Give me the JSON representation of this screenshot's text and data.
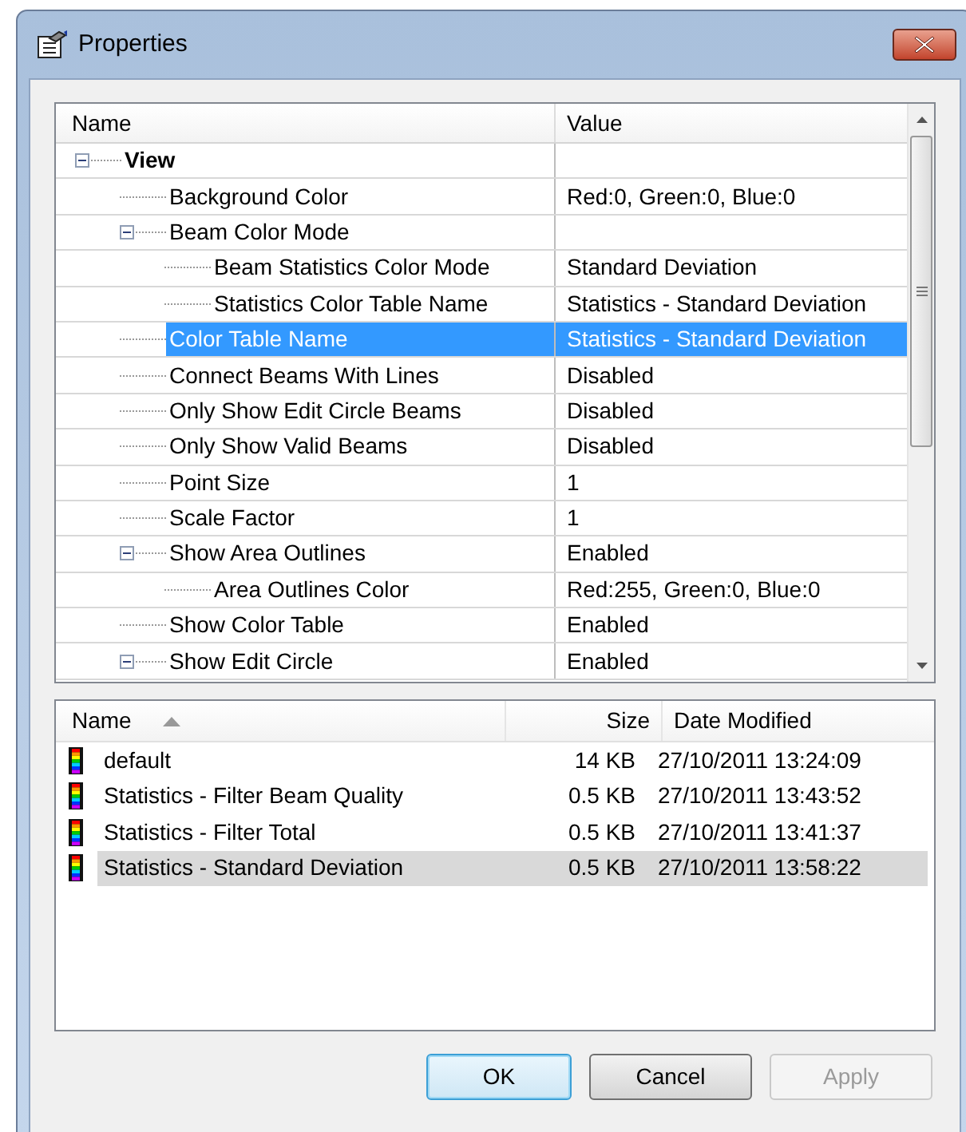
{
  "window": {
    "title": "Properties"
  },
  "property_grid": {
    "columns": [
      "Name",
      "Value"
    ],
    "rows": [
      {
        "name": "View",
        "expanded": true,
        "selected": false,
        "children": [
          {
            "name": "Background Color",
            "value": "Red:0, Green:0, Blue:0",
            "selected": false
          },
          {
            "name": "Beam Color Mode",
            "expanded": true,
            "selected": false,
            "children": [
              {
                "name": "Beam Statistics Color Mode",
                "value": "Standard Deviation",
                "selected": false
              },
              {
                "name": "Statistics Color Table Name",
                "value": "Statistics - Standard Deviation",
                "selected": false
              }
            ]
          },
          {
            "name": "Color Table Name",
            "value": "Statistics - Standard Deviation",
            "selected": true
          },
          {
            "name": "Connect Beams With Lines",
            "value": "Disabled",
            "selected": false
          },
          {
            "name": "Only Show Edit Circle Beams",
            "value": "Disabled",
            "selected": false
          },
          {
            "name": "Only Show Valid Beams",
            "value": "Disabled",
            "selected": false
          },
          {
            "name": "Point Size",
            "value": "1",
            "selected": false
          },
          {
            "name": "Scale Factor",
            "value": "1",
            "selected": false
          },
          {
            "name": "Show Area Outlines",
            "value": "Enabled",
            "expanded": true,
            "selected": false,
            "children": [
              {
                "name": "Area Outlines Color",
                "value": "Red:255, Green:0, Blue:0",
                "selected": false
              }
            ]
          },
          {
            "name": "Show Color Table",
            "value": "Enabled",
            "selected": false
          },
          {
            "name": "Show Edit Circle",
            "value": "Enabled",
            "expanded": true,
            "selected": false
          }
        ]
      }
    ]
  },
  "file_list": {
    "columns": [
      "Name",
      "Size",
      "Date Modified"
    ],
    "rows": [
      {
        "name": "default",
        "size": "14 KB",
        "date": "27/10/2011 13:24:09",
        "selected": false
      },
      {
        "name": "Statistics - Filter Beam Quality",
        "size": "0.5 KB",
        "date": "27/10/2011 13:43:52",
        "selected": false
      },
      {
        "name": "Statistics - Filter Total",
        "size": "0.5 KB",
        "date": "27/10/2011 13:41:37",
        "selected": false
      },
      {
        "name": "Statistics - Standard Deviation",
        "size": "0.5 KB",
        "date": "27/10/2011 13:58:22",
        "selected": true
      }
    ]
  },
  "buttons": [
    {
      "label": "OK",
      "kind": "default",
      "disabled": false
    },
    {
      "label": "Cancel",
      "kind": "normal",
      "disabled": false
    },
    {
      "label": "Apply",
      "kind": "normal",
      "disabled": true
    }
  ]
}
